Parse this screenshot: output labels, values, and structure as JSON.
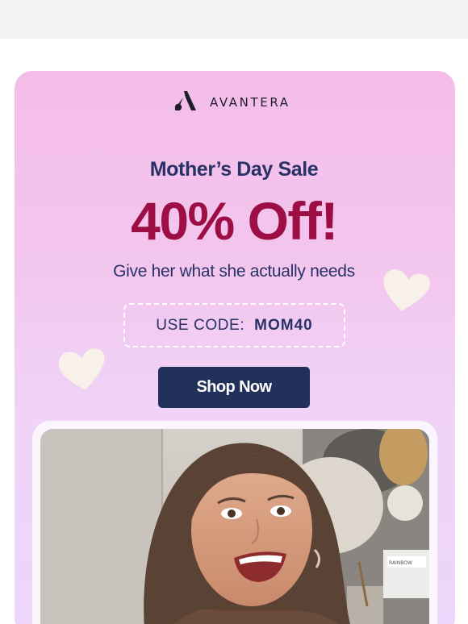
{
  "brand": {
    "name": "AVANTERA",
    "logo_icon": "avantera-logo-icon"
  },
  "promo": {
    "headline": "Mother’s Day Sale",
    "offer": "40% Off!",
    "subline": "Give her what she actually needs",
    "code_label": "USE CODE:",
    "code_value": "MOM40",
    "cta_label": "Shop Now"
  },
  "decorations": {
    "icons": [
      "heart-icon",
      "heart-icon"
    ]
  },
  "photo": {
    "art_label": "RAINBOW"
  },
  "colors": {
    "headline": "#283266",
    "offer": "#9c0e44",
    "cta_background": "#22315a",
    "card_gradient_top": "#f4bde9",
    "card_gradient_bottom": "#ecd6fb",
    "heart": "#f7f1ea"
  }
}
